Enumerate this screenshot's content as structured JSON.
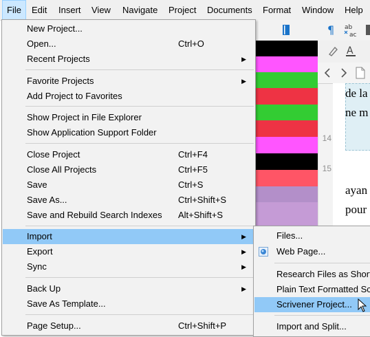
{
  "menubar": {
    "items": [
      "File",
      "Edit",
      "Insert",
      "View",
      "Navigate",
      "Project",
      "Documents",
      "Format",
      "Window",
      "Help"
    ]
  },
  "file_menu": {
    "items": [
      {
        "label": "New Project...",
        "shortcut": ""
      },
      {
        "label": "Open...",
        "shortcut": "Ctrl+O"
      },
      {
        "label": "Recent Projects",
        "shortcut": "",
        "submenu": true
      },
      {
        "label": "Favorite Projects",
        "shortcut": "",
        "submenu": true
      },
      {
        "label": "Add Project to Favorites",
        "shortcut": ""
      },
      {
        "label": "Show Project in File Explorer",
        "shortcut": ""
      },
      {
        "label": "Show Application Support Folder",
        "shortcut": ""
      },
      {
        "label": "Close Project",
        "shortcut": "Ctrl+F4"
      },
      {
        "label": "Close All Projects",
        "shortcut": "Ctrl+F5"
      },
      {
        "label": "Save",
        "shortcut": "Ctrl+S"
      },
      {
        "label": "Save As...",
        "shortcut": "Ctrl+Shift+S"
      },
      {
        "label": "Save and Rebuild Search Indexes",
        "shortcut": "Alt+Shift+S"
      },
      {
        "label": "Import",
        "shortcut": "",
        "submenu": true,
        "highlighted": true
      },
      {
        "label": "Export",
        "shortcut": "",
        "submenu": true
      },
      {
        "label": "Sync",
        "shortcut": "",
        "submenu": true
      },
      {
        "label": "Back Up",
        "shortcut": "",
        "submenu": true
      },
      {
        "label": "Save As Template...",
        "shortcut": ""
      },
      {
        "label": "Page Setup...",
        "shortcut": "Ctrl+Shift+P"
      }
    ]
  },
  "import_submenu": {
    "items": [
      {
        "label": "Files...",
        "icon": ""
      },
      {
        "label": "Web Page...",
        "icon": "web-page-icon"
      },
      {
        "label": "Research Files as Shortcu"
      },
      {
        "label": "Plain Text Formatted Scre"
      },
      {
        "label": "Scrivener Project...",
        "highlighted": true
      },
      {
        "label": "Import and Split..."
      }
    ]
  },
  "editor": {
    "lines": [
      "de la",
      "ne m",
      "ayan",
      "pour"
    ],
    "line_numbers": [
      "14",
      "15"
    ]
  },
  "colors": {
    "menu_bg": "#f2f2f2",
    "highlight": "#91c9f7",
    "menubar_active": "#cce8ff",
    "strips": [
      "#000000",
      "#ff55ff",
      "#33cc33",
      "#ee3344",
      "#33cc33",
      "#ee3344",
      "#ff55ff",
      "#000000",
      "#ff5566",
      "#b38fc9",
      "#c59bd6",
      "#c59bd6"
    ]
  }
}
